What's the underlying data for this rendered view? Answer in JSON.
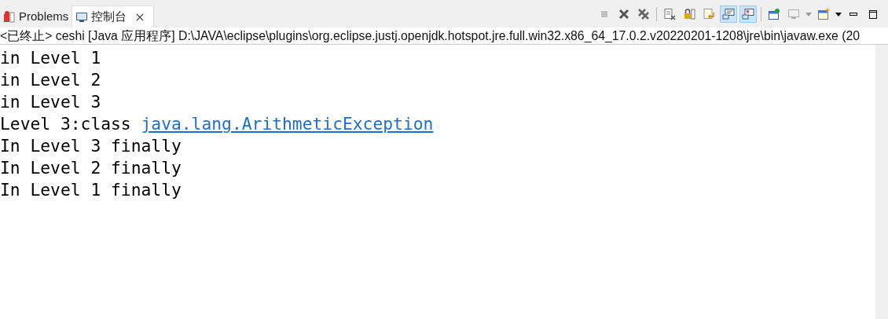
{
  "tabs": [
    {
      "label": "Problems",
      "kind": "problems",
      "selected": false,
      "closable": false
    },
    {
      "label": "控制台",
      "kind": "console",
      "selected": true,
      "closable": true
    }
  ],
  "toolbar": [
    {
      "kind": "terminate",
      "disabled": true,
      "selected": false
    },
    {
      "kind": "remove",
      "disabled": false,
      "selected": false
    },
    {
      "kind": "remove-all",
      "disabled": false,
      "selected": false
    },
    {
      "kind": "separator"
    },
    {
      "kind": "clear",
      "disabled": false,
      "selected": false
    },
    {
      "kind": "lock",
      "disabled": false,
      "selected": false
    },
    {
      "kind": "wrap",
      "disabled": false,
      "selected": false
    },
    {
      "kind": "stdout",
      "disabled": false,
      "selected": true
    },
    {
      "kind": "stderr",
      "disabled": false,
      "selected": true
    },
    {
      "kind": "separator"
    },
    {
      "kind": "pin",
      "disabled": false,
      "selected": false
    },
    {
      "kind": "display",
      "disabled": true,
      "selected": false
    },
    {
      "kind": "dropdown"
    },
    {
      "kind": "new-console",
      "disabled": false,
      "selected": false
    },
    {
      "kind": "dropdown"
    },
    {
      "kind": "minimize",
      "disabled": false,
      "selected": false
    },
    {
      "kind": "maximize",
      "disabled": false,
      "selected": false
    }
  ],
  "process_label": "<已终止> ceshi [Java 应用程序] D:\\JAVA\\eclipse\\plugins\\org.eclipse.justj.openjdk.hotspot.jre.full.win32.x86_64_17.0.2.v20220201-1208\\jre\\bin\\javaw.exe  (20",
  "output": [
    {
      "text": "in Level 1"
    },
    {
      "text": "in Level 2"
    },
    {
      "text": "in Level 3"
    },
    {
      "text": "Level 3:class ",
      "link": "java.lang.ArithmeticException"
    },
    {
      "text": "In Level 3 finally"
    },
    {
      "text": "In Level 2 finally"
    },
    {
      "text": "In Level 1 finally"
    }
  ]
}
